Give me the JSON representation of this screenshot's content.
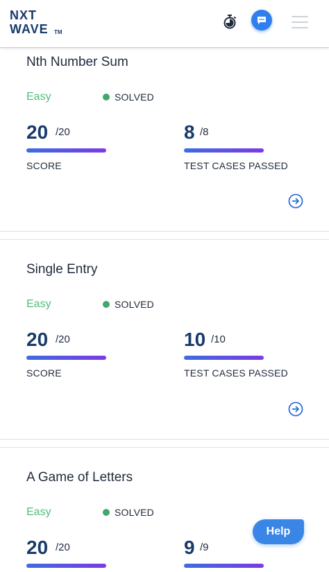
{
  "header": {
    "logo_line1": "NXT",
    "logo_line2": "WAVE",
    "logo_tm": "TM",
    "icons": [
      "stopwatch-icon",
      "chat-icon",
      "menu-icon"
    ]
  },
  "cards": [
    {
      "title": "Nth Number Sum",
      "difficulty": "Easy",
      "status": "SOLVED",
      "score": "20",
      "score_total": "/20",
      "score_label": "SCORE",
      "tests": "8",
      "tests_total": "/8",
      "tests_label": "TEST CASES PASSED"
    },
    {
      "title": "Single Entry",
      "difficulty": "Easy",
      "status": "SOLVED",
      "score": "20",
      "score_total": "/20",
      "score_label": "SCORE",
      "tests": "10",
      "tests_total": "/10",
      "tests_label": "TEST CASES PASSED"
    },
    {
      "title": "A Game of Letters",
      "difficulty": "Easy",
      "status": "SOLVED",
      "score": "20",
      "score_total": "/20",
      "tests": "9",
      "tests_total": "/9"
    }
  ],
  "help_label": "Help",
  "colors": {
    "brand": "#183b6b",
    "easy": "#4fbe79",
    "solved_dot": "#3fa96b",
    "accent": "#2f80ed",
    "bar_start": "#3d6ce0",
    "bar_end": "#7c3ae6"
  }
}
